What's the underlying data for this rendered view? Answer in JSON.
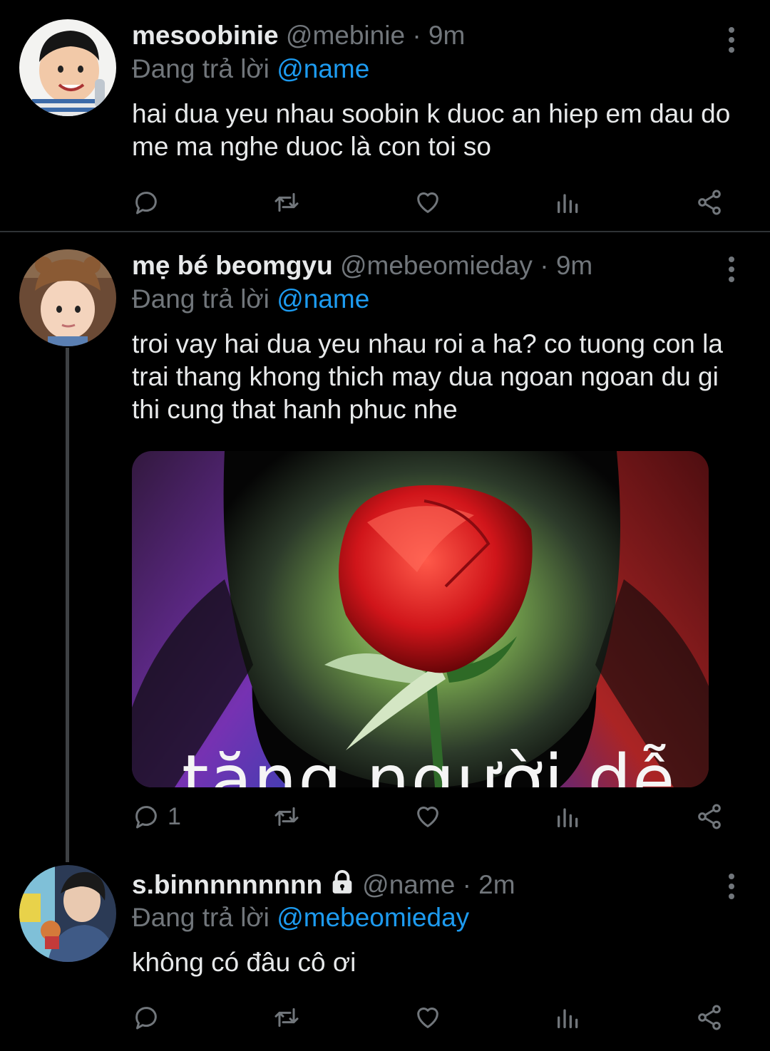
{
  "tweets": [
    {
      "name": "mesoobinie",
      "handle": "@mebinie",
      "separator": "·",
      "time": "9m",
      "reply_prefix": "Đang trả lời",
      "reply_to": "@name",
      "text": "hai dua yeu nhau soobin k duoc an hiep em dau do me ma nghe duoc là con toi so",
      "reply_count": ""
    },
    {
      "name": "mẹ bé beomgyu",
      "handle": "@mebeomieday",
      "separator": "·",
      "time": "9m",
      "reply_prefix": "Đang trả lời",
      "reply_to": "@name",
      "text": "troi vay hai dua yeu nhau roi a ha? co tuong con la trai thang khong thich may dua ngoan ngoan du gi thi cung that hanh phuc nhe",
      "media_caption": "tặng người dễ",
      "reply_count": "1"
    },
    {
      "name": "s.binnnnnnnnn",
      "handle": "@name",
      "separator": "·",
      "time": "2m",
      "reply_prefix": "Đang trả lời",
      "reply_to": "@mebeomieday",
      "text": "không có đâu cô ơi",
      "reply_count": ""
    }
  ],
  "icons": {
    "reply": "reply-icon",
    "retweet": "retweet-icon",
    "like": "heart-icon",
    "views": "analytics-icon",
    "share": "share-icon",
    "more": "more-icon",
    "lock": "lock-icon"
  },
  "colors": {
    "background": "#000000",
    "text": "#e7e9ea",
    "muted": "#71767b",
    "mention": "#1d9bf0",
    "divider": "#2f3336"
  }
}
